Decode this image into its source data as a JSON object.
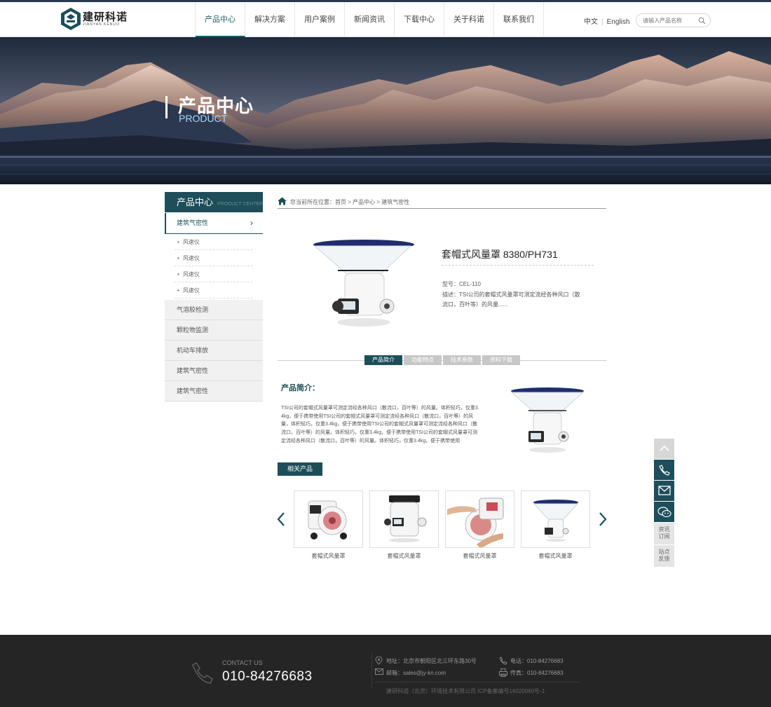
{
  "header": {
    "logo_text": "建研科诺",
    "logo_sub": "JIANYAN KENUO",
    "nav": [
      "产品中心",
      "解决方案",
      "用户案例",
      "新闻资讯",
      "下载中心",
      "关于科诺",
      "联系我们"
    ],
    "lang_cn": "中文",
    "lang_en": "English",
    "search_placeholder": "请输入产品名称"
  },
  "banner": {
    "title": "产品中心",
    "subtitle": "PRODUCT"
  },
  "sidebar": {
    "head_cn": "产品中心",
    "head_en": "PRODUCT CENTER",
    "active": "建筑气密性",
    "sub_items": [
      "风速仪",
      "风速仪",
      "风速仪",
      "风速仪"
    ],
    "categories": [
      "气溶胶检测",
      "颗粒物监测",
      "机动车排放",
      "建筑气密性",
      "建筑气密性"
    ]
  },
  "breadcrumb": {
    "label": "您当前所在位置：",
    "items": [
      "首页",
      "产品中心",
      "建筑气密性"
    ],
    "sep": ">"
  },
  "product": {
    "title": "套帽式风量罩 8380/PH731",
    "model": "型号：CEL-110",
    "desc": "描述：TSI公司的套帽式风量罩可测定流经各种风口（散流口，百叶等）的风量......"
  },
  "tabs": [
    "产品简介",
    "功能特点",
    "技术参数",
    "资料下载"
  ],
  "intro": {
    "title": "产品简介：",
    "text": "TSI公司的套帽式风量罩可测定流经各种风口（散流口，百叶等）的风量。体积轻巧，仅重3.4kg，便于携带使用TSI公司的套帽式风量罩可测定流经各种风口（散流口，百叶等）的风量，体积轻巧，仅重3.4kg，便于携带使用TSI公司的套帽式风量罩可测定流经各种风口（散流口，百叶等）的风量。体积轻巧，仅重3.4kg，便于携带使用TSI公司的套帽式风量罩可测定流经各种风口（散流口，百叶等）的风量。体积轻巧，仅重3.4kg，便于携带使用"
  },
  "related": {
    "title": "相关产品",
    "items": [
      "套帽式风量罩",
      "套帽式风量罩",
      "套帽式风量罩",
      "套帽式风量罩"
    ]
  },
  "float_tools": {
    "news": "资讯\n订阅",
    "feedback": "站点\n反馈"
  },
  "footer": {
    "contact_label": "CONTACT US",
    "contact_phone": "010-84276683",
    "address": "地址：北京市朝阳区北三环东路30号",
    "phone": "电话：010-84276683",
    "email": "邮箱：sales@jy-kn.com",
    "fax": "传真：010-84276683",
    "copyright": "建研科诺（北京）环境技术有限公司   ICP备案编号16020060号-1"
  },
  "colors": {
    "brand": "#1d4e5a",
    "footer_bg": "#252525"
  }
}
